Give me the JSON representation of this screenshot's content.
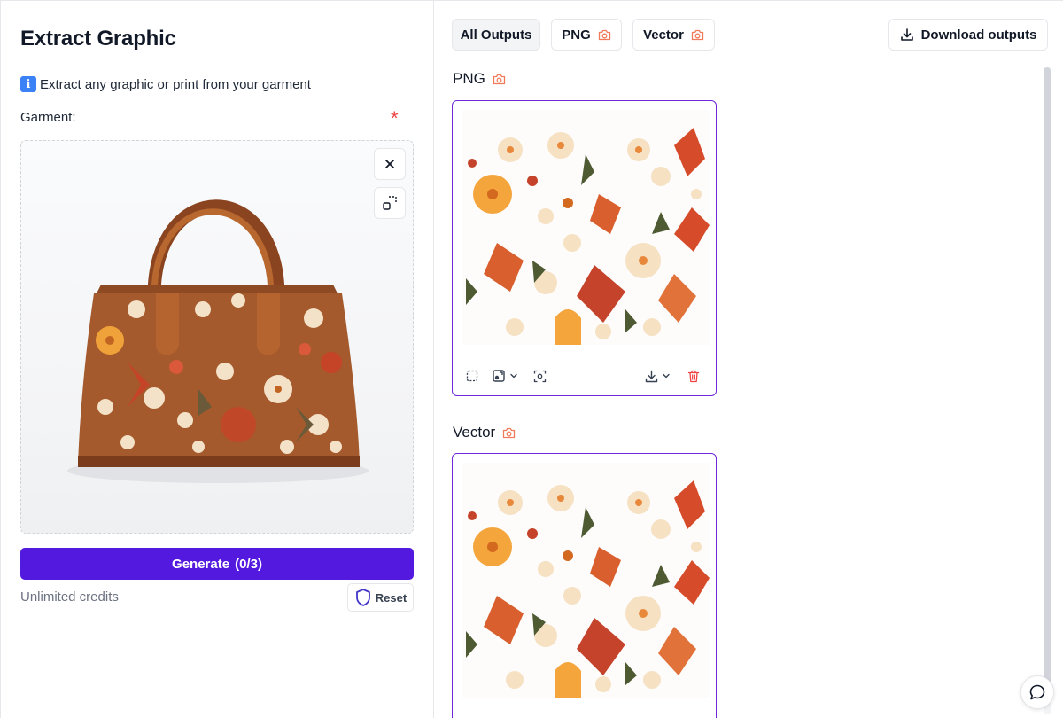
{
  "left_panel": {
    "title": "Extract Graphic",
    "info_text": "Extract any graphic or print from your garment",
    "garment_label": "Garment:",
    "required_marker": "*",
    "generate_label": "Generate",
    "generate_count": "(0/3)",
    "credits_text": "Unlimited credits",
    "reset_label": "Reset"
  },
  "tabs": [
    {
      "label": "All Outputs",
      "active": true,
      "icon": null
    },
    {
      "label": "PNG",
      "active": false,
      "icon": "camera-icon"
    },
    {
      "label": "Vector",
      "active": false,
      "icon": "camera-icon"
    }
  ],
  "download_all_label": "Download outputs",
  "sections": [
    {
      "title": "PNG",
      "icon": "camera-icon"
    },
    {
      "title": "Vector",
      "icon": "camera-icon"
    }
  ],
  "colors": {
    "accent": "#5419de",
    "card_border": "#6d28d9",
    "camera_icon": "#f07b5a",
    "delete_icon": "#ef4444",
    "required": "#ef4444",
    "bag_leather": "#a0522d"
  }
}
